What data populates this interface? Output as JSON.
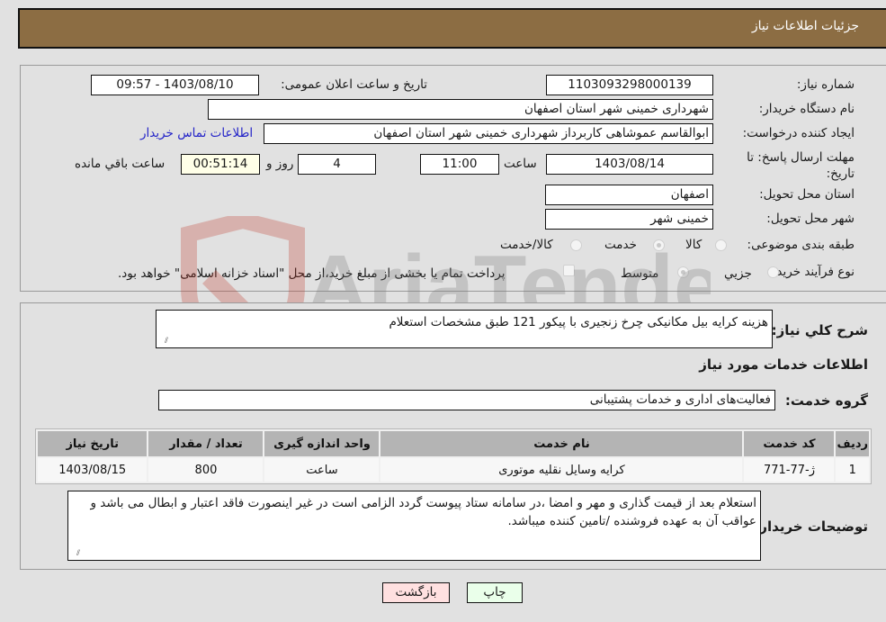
{
  "header": {
    "title": "جزئیات اطلاعات نیاز"
  },
  "details": {
    "need_number": {
      "label": "شماره نیاز:",
      "value": "1103093298000139"
    },
    "announce_datetime": {
      "label": "تاریخ و ساعت اعلان عمومی:",
      "value": "1403/08/10 - 09:57"
    },
    "buyer_org": {
      "label": "نام دستگاه خریدار:",
      "value": "شهرداری خمینی شهر استان اصفهان"
    },
    "requester": {
      "label": "ایجاد کننده درخواست:",
      "value": "ابوالقاسم عموشاهی کاربرداز شهرداری خمینی شهر استان اصفهان"
    },
    "buyer_contact_link": "اطلاعات تماس خریدار",
    "deadline": {
      "label": "مهلت ارسال پاسخ: تا تاریخ:",
      "date": "1403/08/14",
      "time_label": "ساعت",
      "time": "11:00",
      "days": "4",
      "days_label": "روز و",
      "remaining": "00:51:14",
      "remaining_label": "ساعت باقي مانده"
    },
    "delivery_province": {
      "label": "استان محل تحویل:",
      "value": "اصفهان"
    },
    "delivery_city": {
      "label": "شهر محل تحویل:",
      "value": "خمینی شهر"
    },
    "category": {
      "label": "طبقه بندی موضوعی:",
      "options": [
        "کالا",
        "خدمت",
        "کالا/خدمت"
      ],
      "selected": "خدمت"
    },
    "purchase_type": {
      "label": "نوع فرآیند خرید :",
      "options": [
        "جزيي",
        "متوسط"
      ],
      "selected": "متوسط",
      "treasury_note": "پرداخت تمام یا بخشی از مبلغ خرید،از محل \"اسناد خزانه اسلامی\" خواهد بود."
    }
  },
  "summary": {
    "label": "شرح كلي نياز:",
    "value": "هزینه کرایه بیل مکانیکی چرخ زنجیری با پیکور 121 طبق مشخصات استعلام"
  },
  "services_section": {
    "title": "اطلاعات خدمات مورد نیاز",
    "group_label": "گروه خدمت:",
    "group_value": "فعالیت‌های اداری و خدمات پشتیبانی",
    "table": {
      "headers": [
        "ردیف",
        "کد خدمت",
        "نام خدمت",
        "واحد اندازه گیری",
        "تعداد / مقدار",
        "تاریخ نیاز"
      ],
      "rows": [
        [
          "1",
          "ژ-77-771",
          "کرایه وسایل نقلیه موتوری",
          "ساعت",
          "800",
          "1403/08/15"
        ]
      ]
    }
  },
  "buyer_notes": {
    "label": "توضیحات خریدار:",
    "value": "استعلام بعد از قیمت گذاری و مهر و امضا ،در سامانه ستاد پیوست گردد الزامی است در غیر اینصورت فاقد اعتبار و ابطال می باشد و عواقب آن به عهده فروشنده /تامین کننده میباشد."
  },
  "buttons": {
    "print": "چاپ",
    "back": "بازگشت"
  },
  "colors": {
    "header": "#8c6d43",
    "print_button": "#eaffea",
    "back_button": "#ffe0e0",
    "link": "#2323c8"
  },
  "watermark": {
    "text": "AriaTender.neT"
  }
}
